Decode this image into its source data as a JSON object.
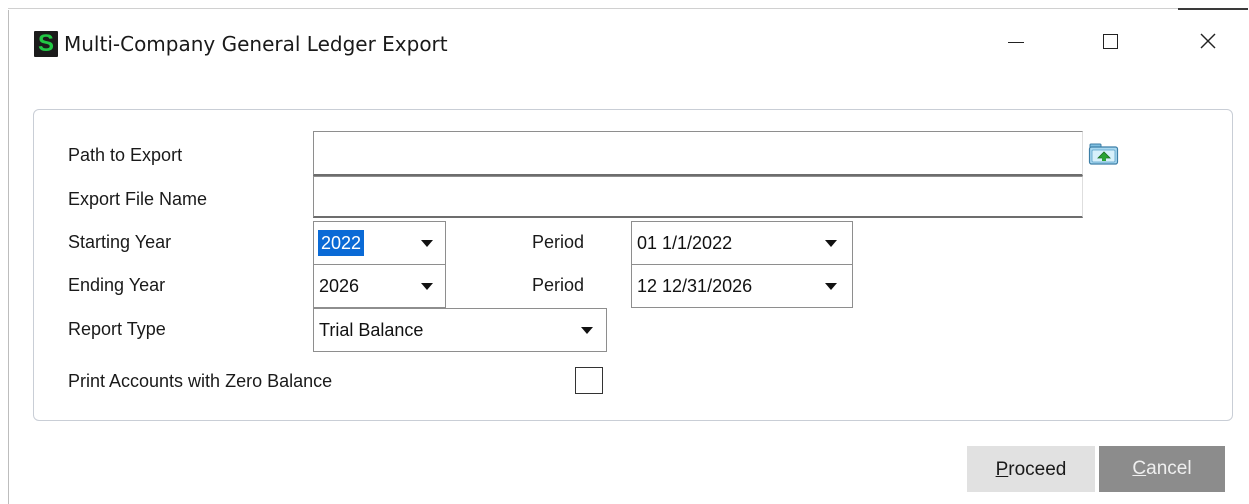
{
  "window": {
    "title": "Multi-Company General Ledger Export",
    "app_icon_letter": "S",
    "app_icon_color": "#22c744"
  },
  "form": {
    "path_to_export": {
      "label": "Path to Export",
      "value": ""
    },
    "export_file_name": {
      "label": "Export File Name",
      "value": ""
    },
    "starting_year": {
      "label": "Starting Year",
      "value": "2022"
    },
    "starting_period": {
      "label": "Period",
      "value": "01 1/1/2022"
    },
    "ending_year": {
      "label": "Ending Year",
      "value": "2026"
    },
    "ending_period": {
      "label": "Period",
      "value": "12 12/31/2026"
    },
    "report_type": {
      "label": "Report Type",
      "value": "Trial Balance"
    },
    "print_zero_balance": {
      "label": "Print Accounts with Zero Balance",
      "checked": false
    }
  },
  "buttons": {
    "proceed": {
      "mnemonic": "P",
      "rest": "roceed"
    },
    "cancel": {
      "mnemonic": "C",
      "rest": "ancel"
    }
  },
  "colors": {
    "selection": "#0a6ad6",
    "cancel_bg": "#8c8c8c",
    "proceed_bg": "#e1e1e1"
  }
}
